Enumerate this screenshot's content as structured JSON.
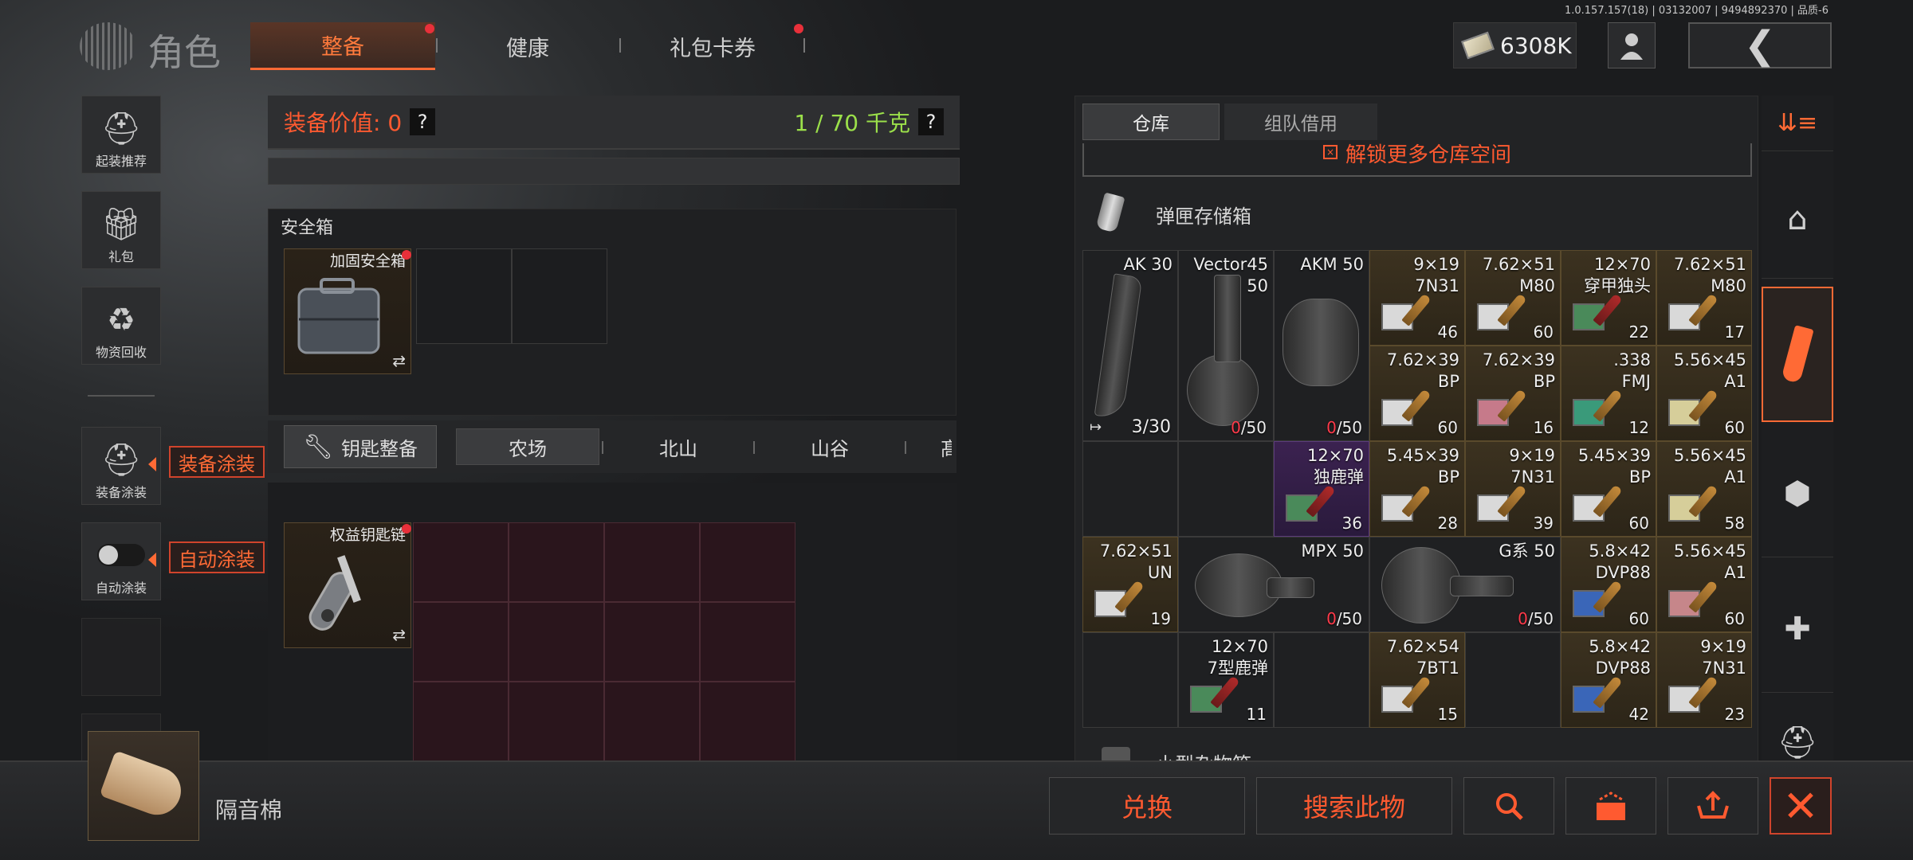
{
  "version": "1.0.157.157(18) | 03132007 | 9494892370 | 品质-6",
  "header": {
    "title": "角色",
    "tabs": [
      "整备",
      "健康",
      "礼包卡券"
    ],
    "money": "6308K"
  },
  "left_sidebar": {
    "items": [
      "起装推荐",
      "礼包",
      "物资回收",
      "装备涂装",
      "自动涂装"
    ],
    "equip_paint_tag": "装备涂装",
    "auto_paint_tag": "自动涂装"
  },
  "equipment": {
    "value_label": "装备价值: 0",
    "weight_label": "1 / 70 千克",
    "help": "?"
  },
  "safe_box": {
    "title": "安全箱",
    "item_name": "加固安全箱",
    "swap": "⇄"
  },
  "key_section": {
    "button": "钥匙整备",
    "tabs": [
      "农场",
      "北山",
      "山谷",
      "髙"
    ],
    "item_name": "权益钥匙链",
    "swap": "⇄"
  },
  "warehouse": {
    "tabs": [
      "仓库",
      "组队借用"
    ],
    "unlock": "解锁更多仓库空间",
    "section_title": "弹匣存储箱",
    "next_section": "小型杂物箱",
    "cells": [
      {
        "name": "AK 30",
        "count": "3/30"
      },
      {
        "name": "Vector45\n50",
        "count": "0",
        "count_suffix": "/50"
      },
      {
        "name": "AKM 50",
        "count": "0",
        "count_suffix": "/50"
      },
      {
        "name": "9×19\n7N31",
        "count": "46"
      },
      {
        "name": "7.62×51\nM80",
        "count": "60"
      },
      {
        "name": "12×70\n穿甲独头",
        "count": "22"
      },
      {
        "name": "7.62×51\nM80",
        "count": "17"
      },
      {
        "name": "7.62×39\nBP",
        "count": "60"
      },
      {
        "name": "7.62×39\nBP",
        "count": "16"
      },
      {
        "name": ".338\nFMJ",
        "count": "12"
      },
      {
        "name": "5.56×45\nA1",
        "count": "60"
      },
      {
        "name": "12×70\n独鹿弹",
        "count": "36"
      },
      {
        "name": "5.45×39\nBP",
        "count": "28"
      },
      {
        "name": "9×19\n7N31",
        "count": "39"
      },
      {
        "name": "5.45×39\nBP",
        "count": "60"
      },
      {
        "name": "5.56×45\nA1",
        "count": "58"
      },
      {
        "name": "7.62×51\nUN",
        "count": "19"
      },
      {
        "name": "MPX 50",
        "count": "0",
        "count_suffix": "/50"
      },
      {
        "name": "G系 50",
        "count": "0",
        "count_suffix": "/50"
      },
      {
        "name": "5.8×42\nDVP88",
        "count": "60"
      },
      {
        "name": "5.56×45\nA1",
        "count": "60"
      },
      {
        "name": "12×70\n7型鹿弹",
        "count": "11"
      },
      {
        "name": "7.62×54\n7BT1",
        "count": "15"
      },
      {
        "name": "5.8×42\nDVP88",
        "count": "42"
      },
      {
        "name": "9×19\n7N31",
        "count": "23"
      }
    ]
  },
  "selected_item": {
    "name": "隔音棉"
  },
  "actions": {
    "exchange": "兑换",
    "search": "搜索此物"
  },
  "colors": {
    "accent": "#ff6a35",
    "green_weight": "#9be04a",
    "red_count": "#ff3a4a"
  }
}
